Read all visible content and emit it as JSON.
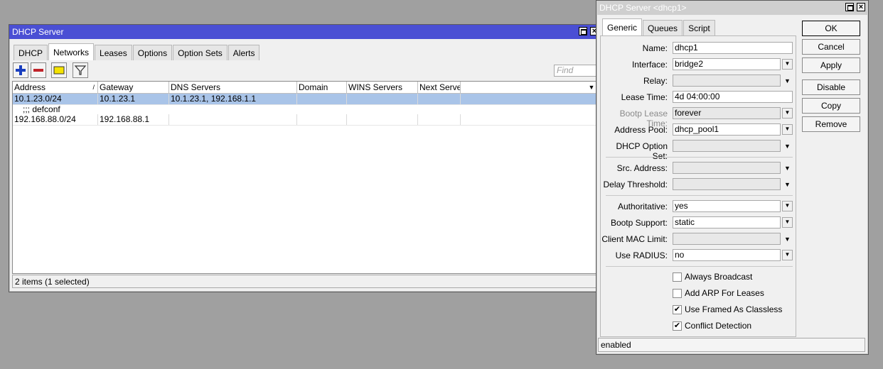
{
  "main_window": {
    "title": "DHCP Server",
    "tabs": [
      "DHCP",
      "Networks",
      "Leases",
      "Options",
      "Option Sets",
      "Alerts"
    ],
    "selected_tab": "Networks",
    "find_placeholder": "Find",
    "columns": [
      "Address",
      "Gateway",
      "DNS Servers",
      "Domain",
      "WINS Servers",
      "Next Server"
    ],
    "rows": [
      {
        "address": "10.1.23.0/24",
        "gateway": "10.1.23.1",
        "dns": "10.1.23.1, 192.168.1.1",
        "selected": true
      },
      {
        "comment": ";;; defconf"
      },
      {
        "address": "192.168.88.0/24",
        "gateway": "192.168.88.1",
        "dns": "",
        "selected": false
      }
    ],
    "status": "2 items (1 selected)"
  },
  "detail_window": {
    "title": "DHCP Server <dhcp1>",
    "tabs": [
      "Generic",
      "Queues",
      "Script"
    ],
    "selected_tab": "Generic",
    "fields": {
      "name": {
        "label": "Name:",
        "value": "dhcp1"
      },
      "interface": {
        "label": "Interface:",
        "value": "bridge2"
      },
      "relay": {
        "label": "Relay:",
        "value": ""
      },
      "lease_time": {
        "label": "Lease Time:",
        "value": "4d 04:00:00"
      },
      "bootp_lease_time": {
        "label": "Bootp Lease Time:",
        "value": "forever"
      },
      "address_pool": {
        "label": "Address Pool:",
        "value": "dhcp_pool1"
      },
      "dhcp_option_set": {
        "label": "DHCP Option Set:",
        "value": ""
      },
      "src_address": {
        "label": "Src. Address:",
        "value": ""
      },
      "delay_threshold": {
        "label": "Delay Threshold:",
        "value": ""
      },
      "authoritative": {
        "label": "Authoritative:",
        "value": "yes"
      },
      "bootp_support": {
        "label": "Bootp Support:",
        "value": "static"
      },
      "client_mac_limit": {
        "label": "Client MAC Limit:",
        "value": ""
      },
      "use_radius": {
        "label": "Use RADIUS:",
        "value": "no"
      }
    },
    "checkboxes": [
      {
        "label": "Always Broadcast",
        "checked": false
      },
      {
        "label": "Add ARP For Leases",
        "checked": false
      },
      {
        "label": "Use Framed As Classless",
        "checked": true
      },
      {
        "label": "Conflict Detection",
        "checked": true
      }
    ],
    "buttons": [
      "OK",
      "Cancel",
      "Apply",
      "Disable",
      "Copy",
      "Remove"
    ],
    "status": "enabled"
  },
  "icons": [
    "add-icon",
    "remove-icon",
    "comment-icon",
    "filter-icon",
    "sort-icon",
    "column-menu-icon",
    "maximize-icon",
    "close-icon",
    "dropdown-arrow-icon"
  ],
  "colors": {
    "active_title": "#4a4fd4",
    "selected_row": "#a9c4e8",
    "add": "#1a3fbf",
    "remove": "#c0242a",
    "comment": "#f5e300"
  }
}
